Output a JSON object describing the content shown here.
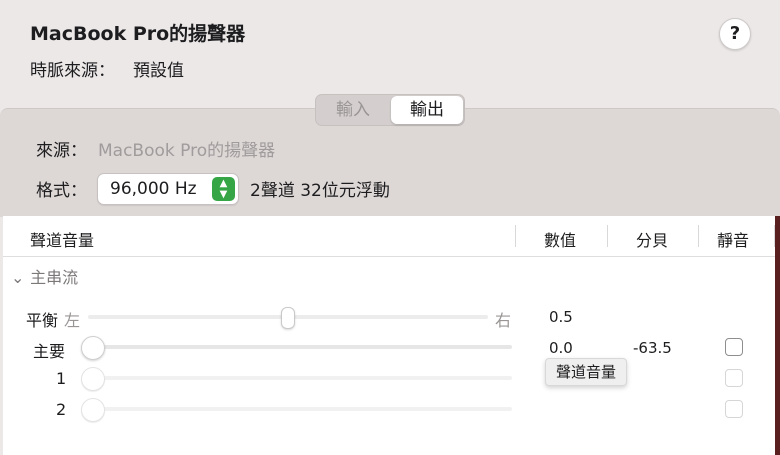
{
  "window": {
    "title": "MacBook Pro的揚聲器",
    "clock_label": "時脈來源：",
    "clock_value": "預設值",
    "help_label": "?"
  },
  "tabs": [
    {
      "label": "輸入",
      "selected": false
    },
    {
      "label": "輸出",
      "selected": true
    }
  ],
  "source": {
    "label": "來源：",
    "value": "MacBook Pro的揚聲器"
  },
  "format": {
    "label": "格式：",
    "selected": "96,000 Hz",
    "stepper_up": "▲",
    "stepper_down": "▼",
    "description": "2聲道 32位元浮動"
  },
  "table": {
    "columns": [
      "聲道音量",
      "數值",
      "分貝",
      "靜音"
    ],
    "group": "主串流",
    "group_chevron": "⌄",
    "balance": {
      "label": "平衡",
      "left": "左",
      "right": "右",
      "value": "0.5",
      "level": 0.5
    },
    "rows": [
      {
        "label": "主要",
        "value": "0.0",
        "db": "-63.5",
        "level": 0.0,
        "mute": false,
        "enabled": true
      },
      {
        "label": "1",
        "value": "",
        "db": "",
        "level": 0.0,
        "mute": false,
        "enabled": false
      },
      {
        "label": "2",
        "value": "",
        "db": "",
        "level": 0.0,
        "mute": false,
        "enabled": false
      }
    ]
  },
  "tooltip": "聲道音量"
}
